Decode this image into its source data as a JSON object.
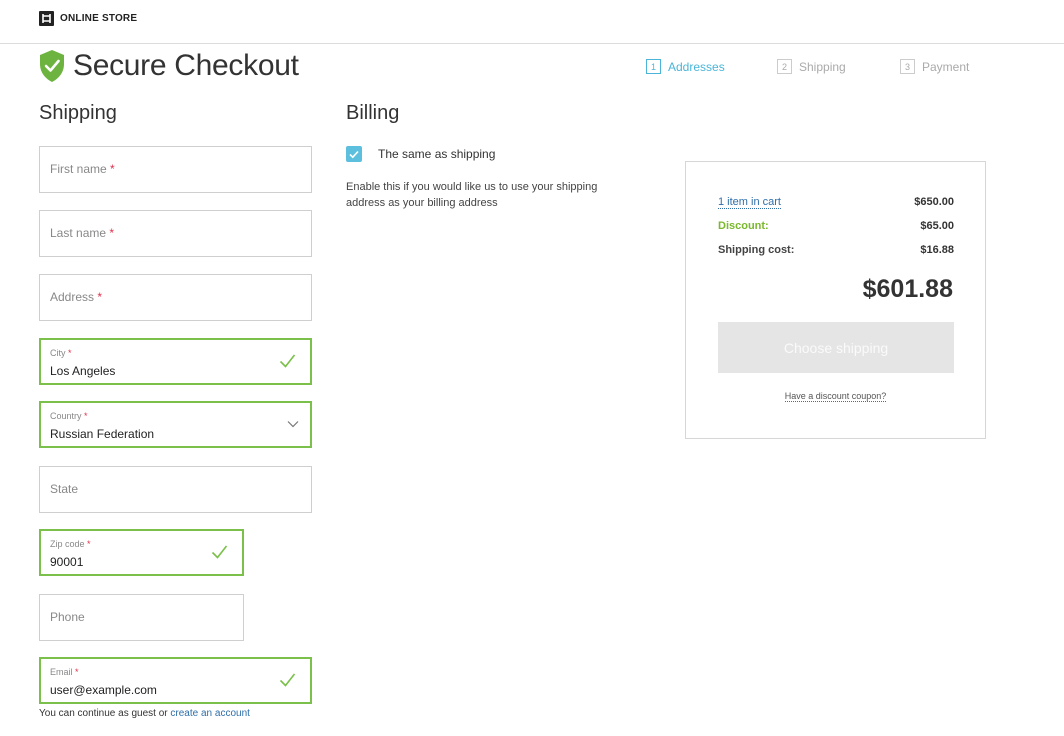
{
  "header": {
    "store_name": "ONLINE STORE"
  },
  "page": {
    "title": "Secure Checkout"
  },
  "steps": [
    {
      "num": "1",
      "label": "Addresses",
      "active": true
    },
    {
      "num": "2",
      "label": "Shipping",
      "active": false
    },
    {
      "num": "3",
      "label": "Payment",
      "active": false
    }
  ],
  "shipping": {
    "title": "Shipping",
    "required_mark": "*",
    "first_name": {
      "placeholder": "First name"
    },
    "last_name": {
      "placeholder": "Last name"
    },
    "address": {
      "placeholder": "Address"
    },
    "city": {
      "label": "City",
      "value": "Los Angeles"
    },
    "country": {
      "label": "Country",
      "value": "Russian Federation"
    },
    "state": {
      "placeholder": "State"
    },
    "zip": {
      "label": "Zip code",
      "value": "90001"
    },
    "phone": {
      "placeholder": "Phone"
    },
    "email": {
      "label": "Email",
      "value": "user@example.com"
    },
    "guest_note": "You can continue as guest or",
    "create_account": "create an account"
  },
  "billing": {
    "title": "Billing",
    "same_label": "The same as shipping",
    "same_checked": true,
    "help": "Enable this if you would like us to use your shipping address as your billing address"
  },
  "summary": {
    "cart_label": "1 item in cart",
    "cart_amount": "$650.00",
    "discount_label": "Discount:",
    "discount_amount": "$65.00",
    "shipping_label": "Shipping cost:",
    "shipping_amount": "$16.88",
    "total": "$601.88",
    "button_label": "Choose shipping",
    "coupon_link": "Have a discount coupon?"
  },
  "colors": {
    "accent": "#4ab5d8",
    "valid": "#7ac04a",
    "required": "#e0314b",
    "link": "#2f6ea8"
  }
}
